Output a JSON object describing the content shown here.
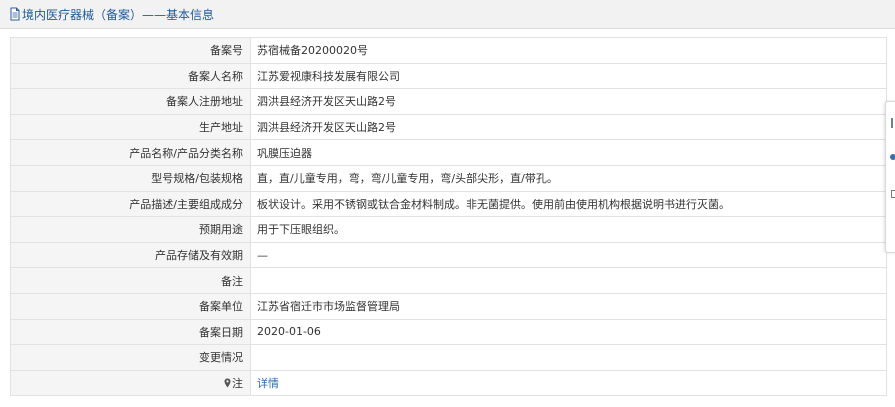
{
  "header": {
    "title": "境内医疗器械（备案）——基本信息",
    "icon": "document-icon"
  },
  "rows": [
    {
      "label": "备案号",
      "value": "苏宿械备20200020号"
    },
    {
      "label": "备案人名称",
      "value": "江苏爱视康科技发展有限公司"
    },
    {
      "label": "备案人注册地址",
      "value": "泗洪县经济开发区天山路2号"
    },
    {
      "label": "生产地址",
      "value": "泗洪县经济开发区天山路2号"
    },
    {
      "label": "产品名称/产品分类名称",
      "value": "巩膜压迫器"
    },
    {
      "label": "型号规格/包装规格",
      "value": "直，直/儿童专用，弯，弯/儿童专用，弯/头部尖形，直/带孔。"
    },
    {
      "label": "产品描述/主要组成成分",
      "value": "板状设计。采用不锈钢或钛合金材料制成。非无菌提供。使用前由使用机构根据说明书进行灭菌。"
    },
    {
      "label": "预期用途",
      "value": "用于下压眼组织。"
    },
    {
      "label": "产品存储及有效期",
      "value": "—"
    },
    {
      "label": "备注",
      "value": ""
    },
    {
      "label": "备案单位",
      "value": "江苏省宿迁市市场监督管理局"
    },
    {
      "label": "备案日期",
      "value": "2020-01-06"
    },
    {
      "label": "变更情况",
      "value": ""
    },
    {
      "label": "注",
      "value": "详情"
    }
  ],
  "colors": {
    "title_blue": "#1f5a98",
    "link_blue": "#2a6bb8",
    "label_bg": "#f5f5f5",
    "header_bg": "#f2f2f2"
  }
}
